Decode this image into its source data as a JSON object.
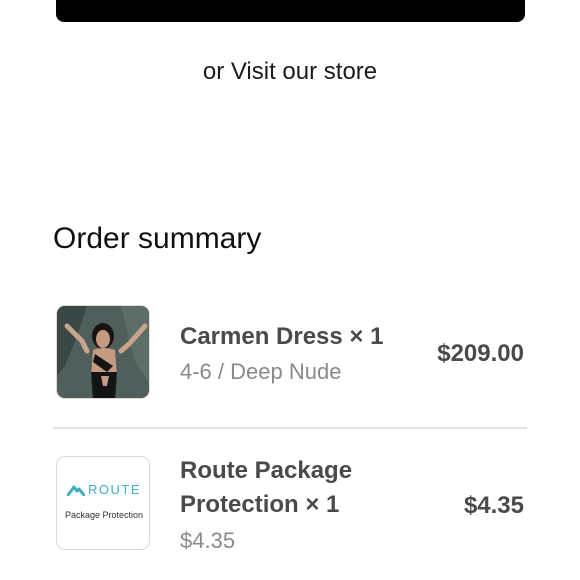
{
  "header": {
    "visit_store_text": "or Visit our store"
  },
  "summary": {
    "title": "Order summary",
    "items": [
      {
        "name": "Carmen Dress × 1",
        "variant": "4-6 / Deep Nude",
        "price": "$209.00",
        "image_icon": "product-photo"
      },
      {
        "name_line1": "Route Package",
        "name_line2": "Protection × 1",
        "unit_price": "$4.35",
        "price": "$4.35",
        "logo_text": "ROUTE",
        "logo_subtext": "Package Protection",
        "logo_color": "#3dafc1"
      }
    ]
  }
}
